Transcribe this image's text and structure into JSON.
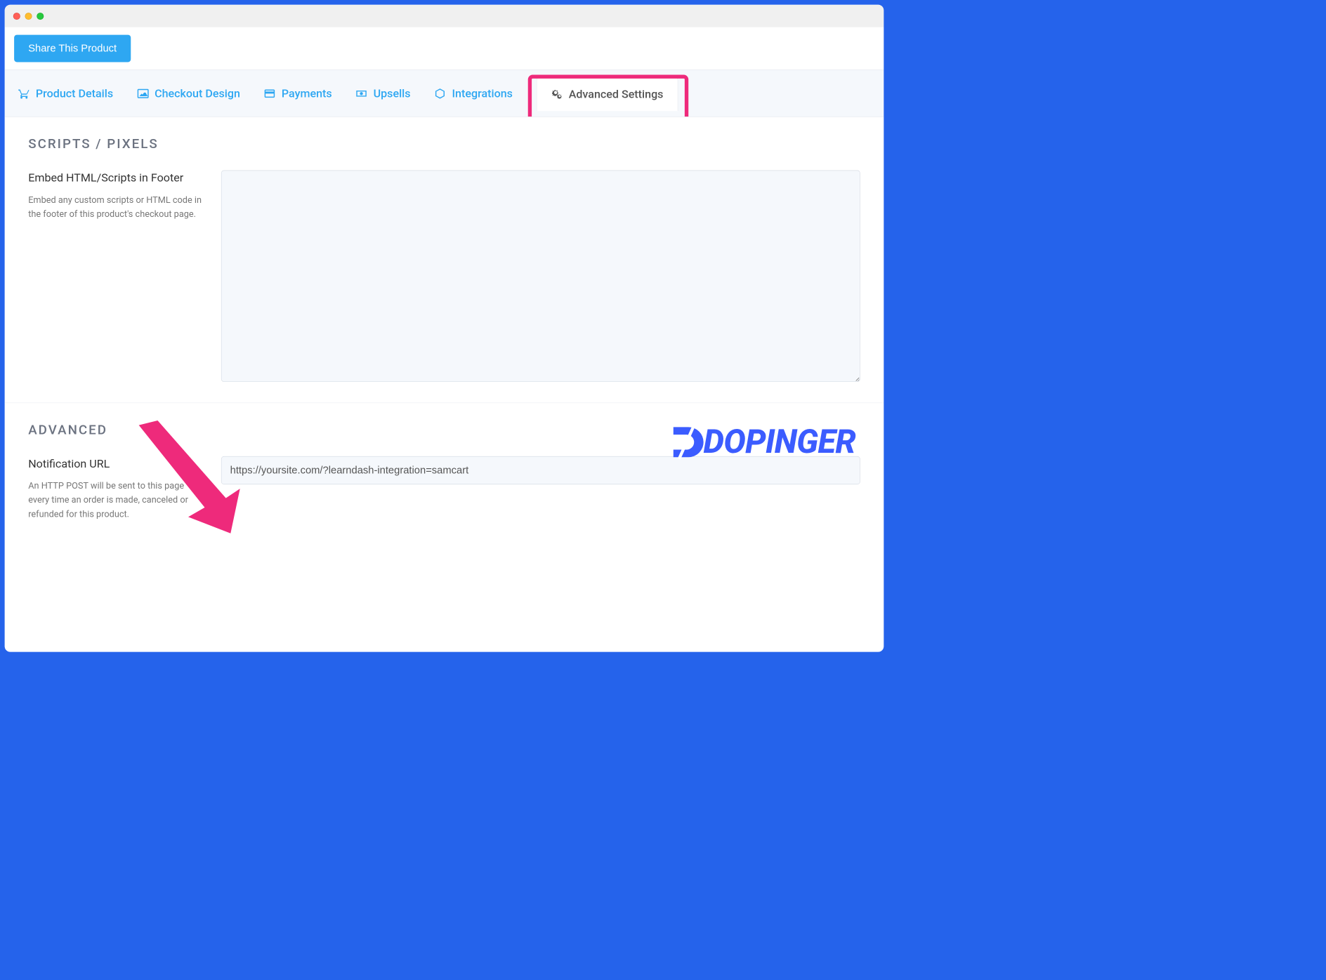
{
  "header": {
    "share_label": "Share This Product"
  },
  "tabs": [
    {
      "label": "Product Details"
    },
    {
      "label": "Checkout Design"
    },
    {
      "label": "Payments"
    },
    {
      "label": "Upsells"
    },
    {
      "label": "Integrations"
    },
    {
      "label": "Advanced Settings"
    }
  ],
  "sections": {
    "scripts": {
      "title": "SCRIPTS / PIXELS",
      "field_label": "Embed HTML/Scripts in Footer",
      "field_desc": "Embed any custom scripts or HTML code in the footer of this product's checkout page.",
      "value": ""
    },
    "advanced": {
      "title": "ADVANCED",
      "field_label": "Notification URL",
      "field_desc": "An HTTP POST will be sent to this page every time an order is made, canceled or refunded for this product.",
      "value": "https://yoursite.com/?learndash-integration=samcart"
    }
  },
  "watermark": "DOPINGER"
}
